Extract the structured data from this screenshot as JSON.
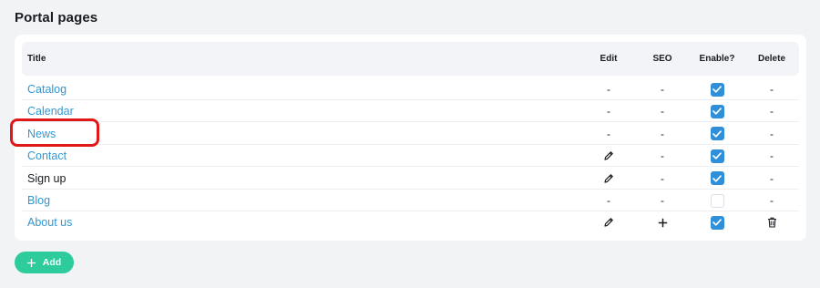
{
  "page": {
    "title": "Portal pages"
  },
  "table": {
    "headers": {
      "title": "Title",
      "edit": "Edit",
      "seo": "SEO",
      "enable": "Enable?",
      "delete": "Delete"
    },
    "rows": [
      {
        "title": "Catalog",
        "title_is_link": true,
        "edit": "-",
        "seo": "-",
        "enabled": true,
        "delete": "-"
      },
      {
        "title": "Calendar",
        "title_is_link": true,
        "edit": "-",
        "seo": "-",
        "enabled": true,
        "delete": "-"
      },
      {
        "title": "News",
        "title_is_link": true,
        "edit": "-",
        "seo": "-",
        "enabled": true,
        "delete": "-"
      },
      {
        "title": "Contact",
        "title_is_link": true,
        "edit": "pencil-icon",
        "seo": "-",
        "enabled": true,
        "delete": "-"
      },
      {
        "title": "Sign up",
        "title_is_link": false,
        "edit": "pencil-icon",
        "seo": "-",
        "enabled": true,
        "delete": "-"
      },
      {
        "title": "Blog",
        "title_is_link": true,
        "edit": "-",
        "seo": "-",
        "enabled": false,
        "delete": "-"
      },
      {
        "title": "About us",
        "title_is_link": true,
        "edit": "pencil-icon",
        "seo": "plus-icon",
        "enabled": true,
        "delete": "trash-icon"
      }
    ]
  },
  "actions": {
    "add_label": "Add",
    "add_icon": "plus-icon"
  },
  "colors": {
    "link": "#3297d3",
    "checkbox_on": "#2f8fd8",
    "add_button": "#2ecb9c",
    "highlight": "#e01818"
  }
}
